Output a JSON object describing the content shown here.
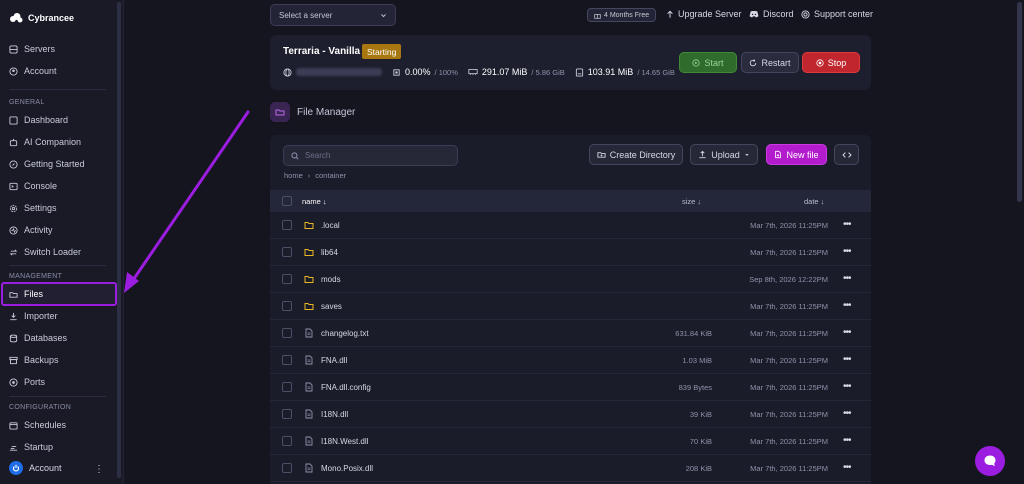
{
  "sidebar": {
    "brand": "Cybrancee",
    "top_items": [
      {
        "label": "Servers",
        "icon": "server-icon"
      },
      {
        "label": "Account",
        "icon": "account-icon"
      }
    ],
    "sections": [
      {
        "title": "GENERAL",
        "items": [
          "Dashboard",
          "AI Companion",
          "Getting Started",
          "Console",
          "Settings",
          "Activity",
          "Switch Loader"
        ]
      },
      {
        "title": "MANAGEMENT",
        "items": [
          "Files",
          "Importer",
          "Databases",
          "Backups",
          "Ports"
        ]
      },
      {
        "title": "CONFIGURATION",
        "items": [
          "Schedules",
          "Startup"
        ]
      }
    ],
    "active_item": "Files",
    "account_label": "Account"
  },
  "topbar": {
    "server_select_placeholder": "Select a server",
    "promo": "4 Months Free",
    "links": [
      "Upgrade Server",
      "Discord",
      "Support center"
    ]
  },
  "server": {
    "name": "Terraria - Vanilla",
    "status": "Starting",
    "cpu": "0.00%",
    "cpu_limit": "/ 100%",
    "memory": "291.07 MiB",
    "memory_limit": "/ 5.86 GiB",
    "disk": "103.91 MiB",
    "disk_limit": "/ 14.65 GiB",
    "buttons": {
      "start": "Start",
      "restart": "Restart",
      "stop": "Stop"
    }
  },
  "file_manager": {
    "title": "File Manager",
    "search_placeholder": "Search",
    "buttons": {
      "create_directory": "Create Directory",
      "upload": "Upload",
      "new_file": "New file"
    },
    "breadcrumb": [
      "home",
      "container"
    ],
    "columns": {
      "name": "name ↓",
      "size": "size ↓",
      "date": "date ↓"
    },
    "rows": [
      {
        "name": ".local",
        "type": "folder",
        "size": "",
        "date": "Mar 7th, 2026 11:25PM"
      },
      {
        "name": "lib64",
        "type": "folder",
        "size": "",
        "date": "Mar 7th, 2026 11:25PM"
      },
      {
        "name": "mods",
        "type": "folder",
        "size": "",
        "date": "Sep 8th, 2026 12:22PM"
      },
      {
        "name": "saves",
        "type": "folder",
        "size": "",
        "date": "Mar 7th, 2026 11:25PM"
      },
      {
        "name": "changelog.txt",
        "type": "file",
        "size": "631.84 KiB",
        "date": "Mar 7th, 2026 11:25PM"
      },
      {
        "name": "FNA.dll",
        "type": "file",
        "size": "1.03 MiB",
        "date": "Mar 7th, 2026 11:25PM"
      },
      {
        "name": "FNA.dll.config",
        "type": "file",
        "size": "839 Bytes",
        "date": "Mar 7th, 2026 11:25PM"
      },
      {
        "name": "I18N.dll",
        "type": "file",
        "size": "39 KiB",
        "date": "Mar 7th, 2026 11:25PM"
      },
      {
        "name": "I18N.West.dll",
        "type": "file",
        "size": "70 KiB",
        "date": "Mar 7th, 2026 11:25PM"
      },
      {
        "name": "Mono.Posix.dll",
        "type": "file",
        "size": "208 KiB",
        "date": "Mar 7th, 2026 11:25PM"
      }
    ]
  },
  "colors": {
    "accent": "#9b1de0",
    "start": "#2f6b2a",
    "stop": "#c0262d",
    "badge": "#a8770f"
  }
}
